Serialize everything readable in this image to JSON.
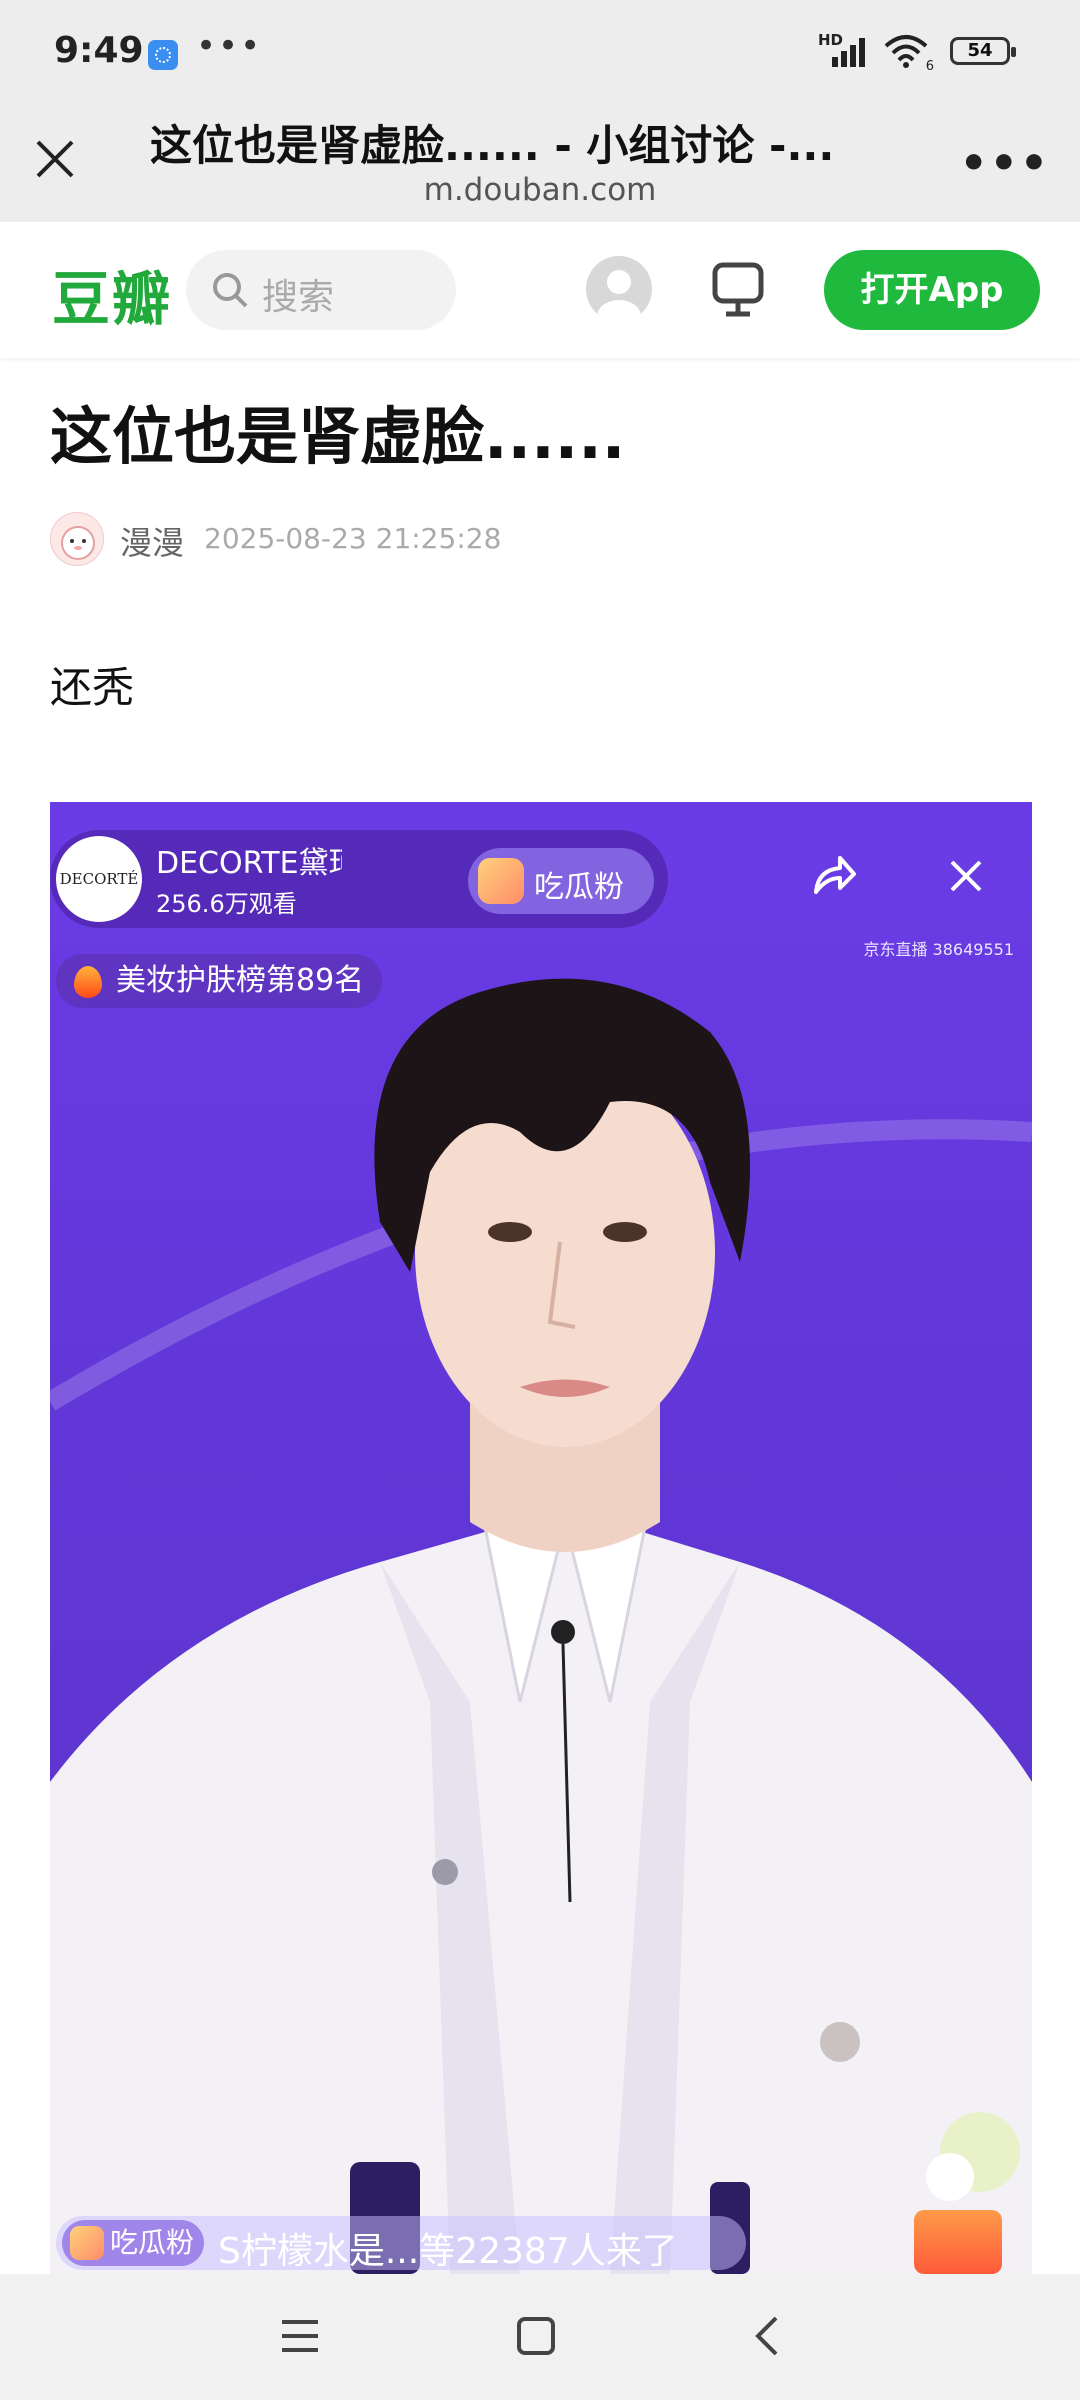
{
  "status_bar": {
    "time": "9:49",
    "dots": "•••",
    "network": "HD",
    "wifi_label": "6",
    "battery": "54",
    "icons": [
      "app-notification-icon",
      "signal-icon",
      "wifi-icon",
      "battery-icon"
    ]
  },
  "browser": {
    "title": "这位也是肾虚脸...... - 小组讨论 -...",
    "url": "m.douban.com",
    "close_icon": "close-icon",
    "more_icon": "more-icon"
  },
  "header": {
    "logo": "豆瓣",
    "search_placeholder": "搜索",
    "open_app": "打开App",
    "accent": "#1fba3d"
  },
  "post": {
    "title": "这位也是肾虚脸......",
    "author": "漫漫",
    "datetime": "2025-08-23 21:25:28",
    "body": "还秃"
  },
  "media": {
    "brand": "DECORTÉ",
    "room_name": "DECORTE黛珂京东自营",
    "viewers": "256.6万观看",
    "fan_button": "吃瓜粉",
    "room_id": "京东直播 38649551",
    "rank": "美妆护肤榜第89名",
    "bottom_fan": "吃瓜粉",
    "bottom_message": "S柠檬水是...等22387人来了",
    "background": "#6a3ce6"
  },
  "nav": {
    "icons": [
      "menu-icon",
      "home-icon",
      "back-icon"
    ]
  }
}
